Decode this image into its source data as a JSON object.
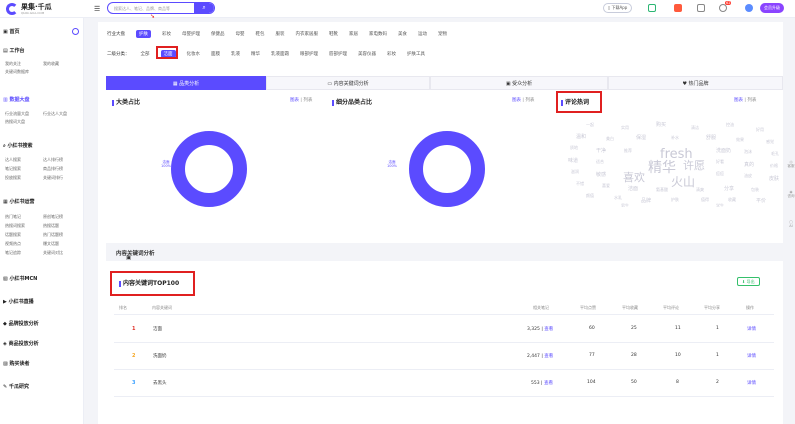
{
  "header": {
    "logo_name": "果集·千瓜",
    "logo_sub": "QIAN-GUA.COM",
    "search_placeholder": "搜索达人、笔记、品牌、商品等",
    "download": "下载App",
    "badge": "62",
    "vip": "会员升级"
  },
  "sidebar": {
    "home": "首页",
    "g1": "工作台",
    "g1_items": [
      "我的关注",
      "我的收藏",
      "关键词数据库",
      "品牌追踪"
    ],
    "g2": "数据大盘",
    "g2_items": [
      "行业流量大盘",
      "行业达人大盘",
      "热搜词大盘"
    ],
    "g3": "小红书搜索",
    "g3_items": [
      "达人搜索",
      "达人排行榜",
      "笔记搜索",
      "商品排行榜",
      "投放搜索",
      "关键词排行"
    ],
    "g4": "小红书运营",
    "g4_items": [
      "热门笔记",
      "原创笔记榜",
      "热搜词搜索",
      "热搜话题",
      "话题搜索",
      "热门话题榜",
      "视频热点",
      "爆文话题",
      "笔记追踪",
      "关键词对比"
    ],
    "g5": "小红书MCN",
    "g6": "小红书直播",
    "g7": "品牌投放分析",
    "g8": "商品投放分析",
    "g9": "购买读者",
    "g10": "千瓜研究"
  },
  "tabs": {
    "row1_label": "行业大盘",
    "row1": [
      "护肤",
      "彩妆",
      "母婴护理",
      "保健品",
      "母婴",
      "鞋包",
      "服装",
      "内衣家居服",
      "鞋靴",
      "家居",
      "家电数码",
      "美食",
      "运动",
      "宠物"
    ],
    "row2_label": "二级分类：",
    "row2": [
      "全部",
      "洁面",
      "化妆水",
      "面膜",
      "乳液",
      "精华",
      "乳液面霜",
      "眼部护理",
      "唇部护理",
      "美容仪器",
      "彩妆",
      "护肤工具"
    ]
  },
  "sections": [
    "品类分析",
    "内容关键词分析",
    "受众分析",
    "热门品牌"
  ],
  "panels": {
    "p1_title": "大类占比",
    "p2_title": "细分品类占比",
    "p3_title": "评论热词",
    "view_chart": "图表",
    "view_list": "列表",
    "donut_label": "洁面",
    "donut_pct": "100%"
  },
  "cloud": {
    "words": [
      "fresh",
      "精华",
      "许愿",
      "喜欢",
      "火山",
      "一起",
      "实用",
      "购买",
      "清洁",
      "控油",
      "好用",
      "温和",
      "美白",
      "保湿",
      "补水",
      "舒服",
      "效果",
      "感觉",
      "质地",
      "干净",
      "推荐",
      "洗面奶",
      "泡沫",
      "毛孔",
      "味道",
      "适合",
      "好看",
      "真的",
      "价格",
      "滋润",
      "敏感",
      "痘痘",
      "油皮",
      "皮肤",
      "不错",
      "喜爱",
      "洁面",
      "氨基酸",
      "清爽",
      "分享",
      "包装",
      "颜值",
      "水乳",
      "品牌",
      "护肤",
      "值得",
      "收藏",
      "平价",
      "男生",
      "学生"
    ]
  },
  "kw": {
    "section": "内容关键词分析",
    "title": "内容关键词TOP100",
    "export": "导出",
    "headers": [
      "排名",
      "内容关键词",
      "相关笔记",
      "平均点赞",
      "平均收藏",
      "平均评论",
      "平均分享",
      "操作"
    ],
    "rows": [
      {
        "rank": "1",
        "word": "洁面",
        "notes": "3,325",
        "likes": "60",
        "fav": "25",
        "cmt": "11",
        "share": "1"
      },
      {
        "rank": "2",
        "word": "洗面奶",
        "notes": "2,447",
        "likes": "77",
        "fav": "28",
        "cmt": "10",
        "share": "1"
      },
      {
        "rank": "3",
        "word": "去黑头",
        "notes": "553",
        "likes": "104",
        "fav": "50",
        "cmt": "8",
        "share": "2"
      }
    ],
    "view": "查看",
    "detail": "详情"
  },
  "float": [
    "客服",
    "咨询",
    "AI"
  ]
}
